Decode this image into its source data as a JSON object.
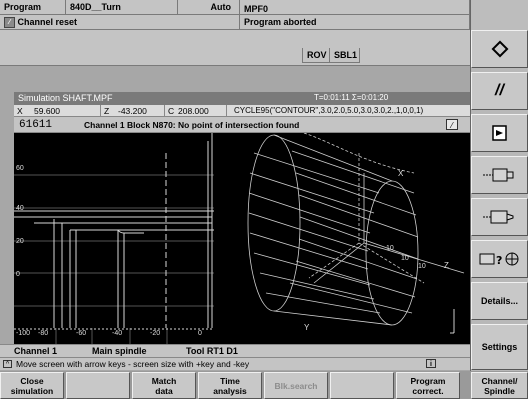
{
  "header": {
    "area": "Program",
    "channel": "840D__Turn",
    "mode": "Auto",
    "program": "MPF0",
    "channel_status": "Channel reset",
    "program_status": "Program aborted",
    "flags": [
      "ROV",
      "SBL1"
    ]
  },
  "simulation": {
    "title": "Simulation  SHAFT.MPF",
    "time_label": "T=0:01:11  Σ=0:01:20",
    "x_axis": "X",
    "x_value": "59.600",
    "z_axis": "Z",
    "z_value": "-43.200",
    "c_axis": "C",
    "c_value": "208.000",
    "cycle": "CYCLE95(\"CONTOUR\",3.0,2.0,5.0,3.0,3.0,2.,1,0,0,1)",
    "alarm_number": "61611",
    "alarm_text": "Channel 1 Block N870: No point of intersection found",
    "left_y_ticks": [
      "60",
      "40",
      "20",
      "0"
    ],
    "left_x_ticks": [
      "-100",
      "-80",
      "-60",
      "-40",
      "-20",
      "0"
    ],
    "right_labels": [
      "X",
      "10",
      "10",
      "10",
      "Z",
      "Y"
    ],
    "footer_channel": "Channel 1",
    "footer_spindle": "Main spindle",
    "footer_tool": "Tool RT1 D1"
  },
  "hint": "Move screen with arrow keys - screen size with +key and -key",
  "right_softkeys": [
    {
      "icon": "diamond-icon",
      "label": ""
    },
    {
      "icon": "double-slash-icon",
      "label": ""
    },
    {
      "icon": "program-pointer-icon",
      "label": ""
    },
    {
      "icon": "tool-left-icon",
      "label": ""
    },
    {
      "icon": "tool-right-icon",
      "label": ""
    },
    {
      "icon": "tool-search-icon",
      "label": ""
    },
    {
      "label": "Details..."
    },
    {
      "label": "Settings"
    }
  ],
  "bottom_softkeys": [
    {
      "label": "Close\nsimulation",
      "enabled": true
    },
    {
      "label": "",
      "enabled": true
    },
    {
      "label": "Match\ndata",
      "enabled": true
    },
    {
      "label": "Time\nanalysis",
      "enabled": true
    },
    {
      "label": "Blk.search",
      "enabled": false
    },
    {
      "label": "",
      "enabled": true
    },
    {
      "label": "Program\ncorrect.",
      "enabled": true
    },
    {
      "label": "Channel/\nSpindle",
      "enabled": true
    }
  ]
}
